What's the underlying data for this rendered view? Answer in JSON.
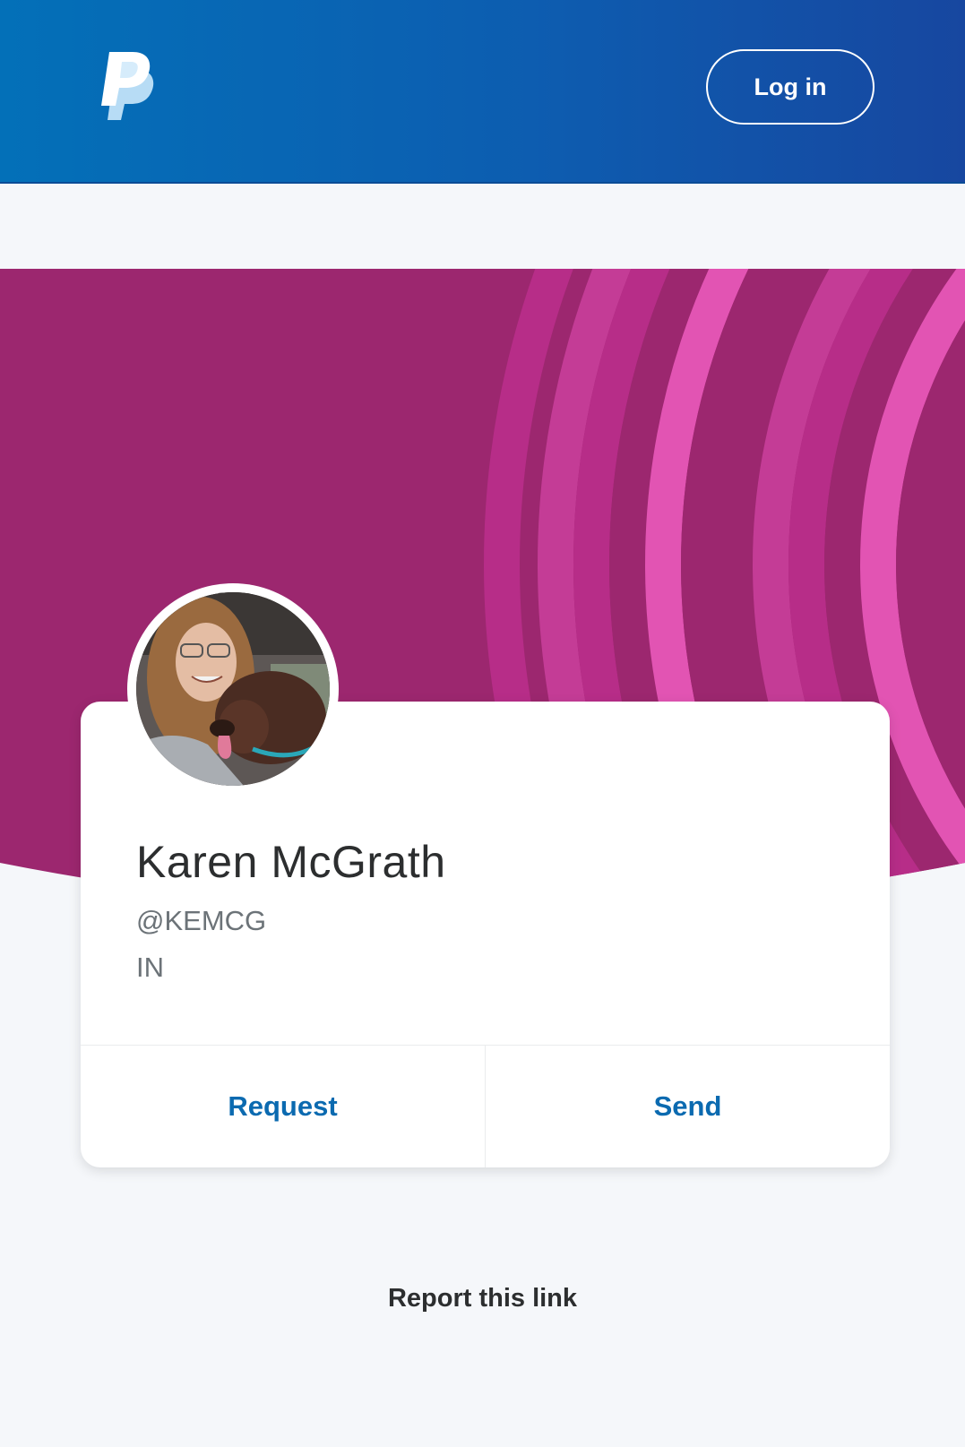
{
  "header": {
    "logo_icon": "paypal-logo-icon",
    "login_label": "Log in",
    "background_color": "#0d5db0"
  },
  "hero": {
    "background_color": "#9c276f",
    "arc_colors": [
      "#b72d88",
      "#c43c96",
      "#e254b3"
    ]
  },
  "profile": {
    "name": "Karen McGrath",
    "handle": "@KEMCG",
    "country": "IN",
    "avatar_icon": "profile-photo"
  },
  "actions": {
    "request_label": "Request",
    "send_label": "Send",
    "accent_color": "#0b6ab0"
  },
  "footer": {
    "report_label": "Report this link"
  }
}
